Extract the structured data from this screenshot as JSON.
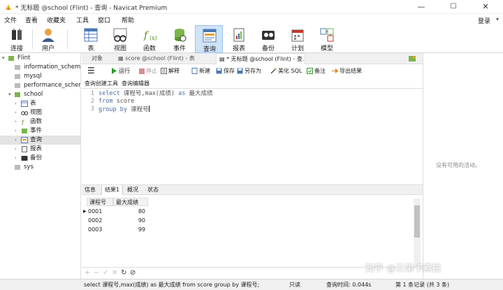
{
  "window": {
    "title": "* 无标题 @school (Flint) - 查询 - Navicat Premium",
    "minimize": "—",
    "maximize": "☐",
    "close": "✕"
  },
  "menu": {
    "items": [
      "文件",
      "查看",
      "收藏夹",
      "工具",
      "窗口",
      "帮助"
    ],
    "login": "登录"
  },
  "toolbar": {
    "items": [
      {
        "label": "连接",
        "icon": "connection-icon"
      },
      {
        "label": "用户",
        "icon": "user-icon"
      },
      {
        "label": "表",
        "icon": "table-icon"
      },
      {
        "label": "视图",
        "icon": "view-icon"
      },
      {
        "label": "函数",
        "icon": "function-icon"
      },
      {
        "label": "事件",
        "icon": "event-icon"
      },
      {
        "label": "查询",
        "icon": "query-icon",
        "active": true
      },
      {
        "label": "报表",
        "icon": "report-icon"
      },
      {
        "label": "备份",
        "icon": "backup-icon"
      },
      {
        "label": "计划",
        "icon": "schedule-icon"
      },
      {
        "label": "模型",
        "icon": "model-icon"
      }
    ]
  },
  "tree": {
    "connection": "Flint",
    "databases": [
      "information_schema",
      "mysql",
      "performance_schema"
    ],
    "school": "school",
    "school_children": [
      "表",
      "视图",
      "函数",
      "事件",
      "查询",
      "报表",
      "备份"
    ],
    "sys": "sys"
  },
  "tabs": {
    "objects": "对象",
    "score": "score @school (Flint) - 表",
    "query": "* 无标题 @school (Flint) - 查..."
  },
  "query_toolbar": {
    "run": "运行",
    "stop": "停止",
    "explain": "解释",
    "new": "新建",
    "save": "保存",
    "save_as": "另存为",
    "beautify": "美化 SQL",
    "comment": "备注",
    "export": "导出结果"
  },
  "subtabs": {
    "builder": "查询创建工具",
    "editor": "查询编辑器"
  },
  "editor": {
    "lines": [
      {
        "num": "1",
        "kw1": "select",
        "text1": " 课程号,max(成绩) ",
        "kw2": "as",
        "text2": " 最大成绩"
      },
      {
        "num": "2",
        "kw1": "from",
        "text1": " score",
        "kw2": "",
        "text2": ""
      },
      {
        "num": "3",
        "kw1": "group by",
        "text1": " 课程号",
        "kw2": "",
        "text2": ""
      }
    ]
  },
  "result_tabs": [
    "信息",
    "结果1",
    "概况",
    "状态"
  ],
  "grid": {
    "columns": [
      "课程号",
      "最大成绩"
    ],
    "rows": [
      {
        "marker": "▶",
        "code": "0001",
        "max": "80"
      },
      {
        "marker": "",
        "code": "0002",
        "max": "90"
      },
      {
        "marker": "",
        "code": "0003",
        "max": "99"
      }
    ]
  },
  "grid_footer": [
    "+",
    "−",
    "✓",
    "✕",
    "↻",
    "⊘"
  ],
  "status": {
    "sql": "select 课程号,max(成绩) as 最大成绩 from score group by 课程号;",
    "mode": "只读",
    "time": "查询时间: 0.044s",
    "records": "第 1 条记录 (共 3 条)"
  },
  "right_pane": {
    "empty_text": "没有可用的活动。"
  },
  "watermark": "知乎 @三弟卡索拉",
  "colors": {
    "accent": "#cfe3f7",
    "keyword": "#4a6fa5",
    "run_green": "#2e9a2e",
    "stop_red": "#c0392b"
  }
}
